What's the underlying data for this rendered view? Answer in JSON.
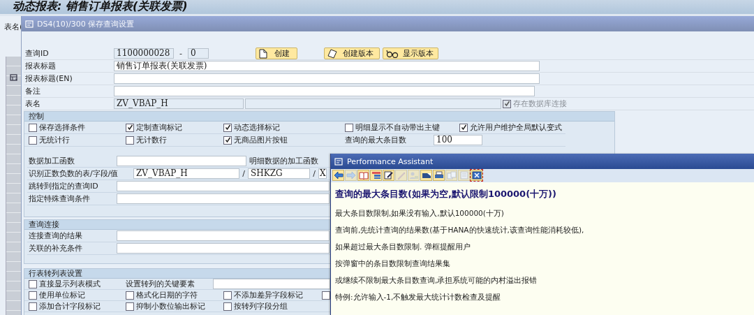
{
  "page_title": "动态报表: 销售订单报表(关联发票)",
  "background_label": "表名(",
  "dialog": {
    "title": "DS4(10)/300 保存查询设置",
    "query": {
      "label": "查询ID",
      "id": "1100000028",
      "dash": "-",
      "version": "0"
    },
    "buttons": [
      {
        "label": "创建",
        "kind": "document"
      },
      {
        "label": "创建版本",
        "kind": "tilted-document"
      },
      {
        "label": "显示版本",
        "kind": "glasses"
      }
    ],
    "fields": [
      {
        "label": "报表标题",
        "value": "销售订单报表(关联发票)"
      },
      {
        "label": "报表标题(EN)"
      },
      {
        "label": "备注"
      }
    ],
    "table_name": {
      "label": "表名",
      "value": "ZV_VBAP_H",
      "db_link": {
        "label": "存在数据库连接",
        "checked": true,
        "disabled": true
      }
    },
    "control": {
      "title": "控制",
      "checkbox_rows": [
        [
          {
            "label": "保存选择条件",
            "checked": false
          },
          {
            "label": "定制查询标记",
            "checked": true
          },
          {
            "label": "动态选择标记",
            "checked": true
          },
          {
            "label": "明细显示不自动带出主键",
            "checked": false
          },
          {
            "label": "允许用户维护全局默认变式",
            "checked": true
          }
        ],
        [
          {
            "label": "无统计行",
            "checked": false
          },
          {
            "label": "无计数行",
            "checked": false
          },
          {
            "label": "无商品图片按钮",
            "checked": true
          }
        ]
      ],
      "max_entries": {
        "label": "查询的最大条目数",
        "value": "100"
      },
      "processing": {
        "label": "数据加工函数",
        "detail_label": "明细数据的加工函数"
      },
      "sign": {
        "label": "识别正数负数的表/字段/值",
        "parts": [
          {
            "value": "ZV_VBAP_H"
          },
          {
            "separator": "/",
            "value": "SHKZG"
          },
          {
            "separator": "/",
            "value": "X"
          }
        ]
      },
      "fields": [
        {
          "label": "跳转到指定的查询ID"
        },
        {
          "label": "指定特殊查询条件"
        }
      ]
    },
    "join": {
      "title": "查询连接",
      "fields": [
        {
          "label": "连接查询的结果"
        },
        {
          "label": "关联的补充条件"
        }
      ]
    },
    "transpose": {
      "title": "行表转列表设置",
      "direct": {
        "label": "直接显示列表模式",
        "checked": false
      },
      "key_label": "设置转列的关键要素",
      "checkbox_rows": [
        [
          {
            "label": "使用单位标记",
            "checked": false
          },
          {
            "label": "格式化日期的字符",
            "checked": false
          },
          {
            "label": "不添加差异字段标记",
            "checked": false
          },
          {
            "checked": false
          }
        ],
        [
          {
            "label": "添加合计字段标记",
            "checked": false
          },
          {
            "label": "抑制小数位输出标记",
            "checked": false
          },
          {
            "label": "按转列字段分组",
            "checked": false
          }
        ]
      ]
    }
  },
  "assistant": {
    "title": "Performance Assistant",
    "tools": [
      {
        "kind": "back",
        "disabled": false,
        "selected": false
      },
      {
        "kind": "forward",
        "disabled": true,
        "selected": false
      },
      {
        "kind": "book",
        "disabled": false,
        "selected": false
      },
      {
        "kind": "tree",
        "disabled": false,
        "selected": false
      },
      {
        "kind": "edit",
        "disabled": false,
        "selected": false
      },
      {
        "kind": "pen",
        "disabled": true,
        "selected": false
      },
      {
        "kind": "person",
        "disabled": true,
        "selected": false
      },
      {
        "kind": "window",
        "disabled": false,
        "selected": false
      },
      {
        "kind": "print",
        "disabled": false,
        "selected": false
      },
      {
        "kind": "copy",
        "disabled": true,
        "selected": false
      },
      {
        "kind": "page",
        "disabled": true,
        "selected": false
      },
      {
        "kind": "close",
        "disabled": false,
        "selected": true
      }
    ],
    "heading": "查询的最大条目数(如果为空,默认限制100000(十万))",
    "paragraphs": [
      "最大条目数限制,如果没有输入,默认100000(十万)",
      "查询前,先统计查询的结果数(基于HANA的快速统计,该查询性能消耗较低),",
      "如果超过最大条目数限制. 弹框提醒用户",
      "按弹窗中的条目数限制查询结果集",
      "或继续不限制最大条目数查询,承担系统可能的内村溢出报错",
      "特例:允许输入-1,不触发最大统计计数检查及提醒"
    ]
  }
}
